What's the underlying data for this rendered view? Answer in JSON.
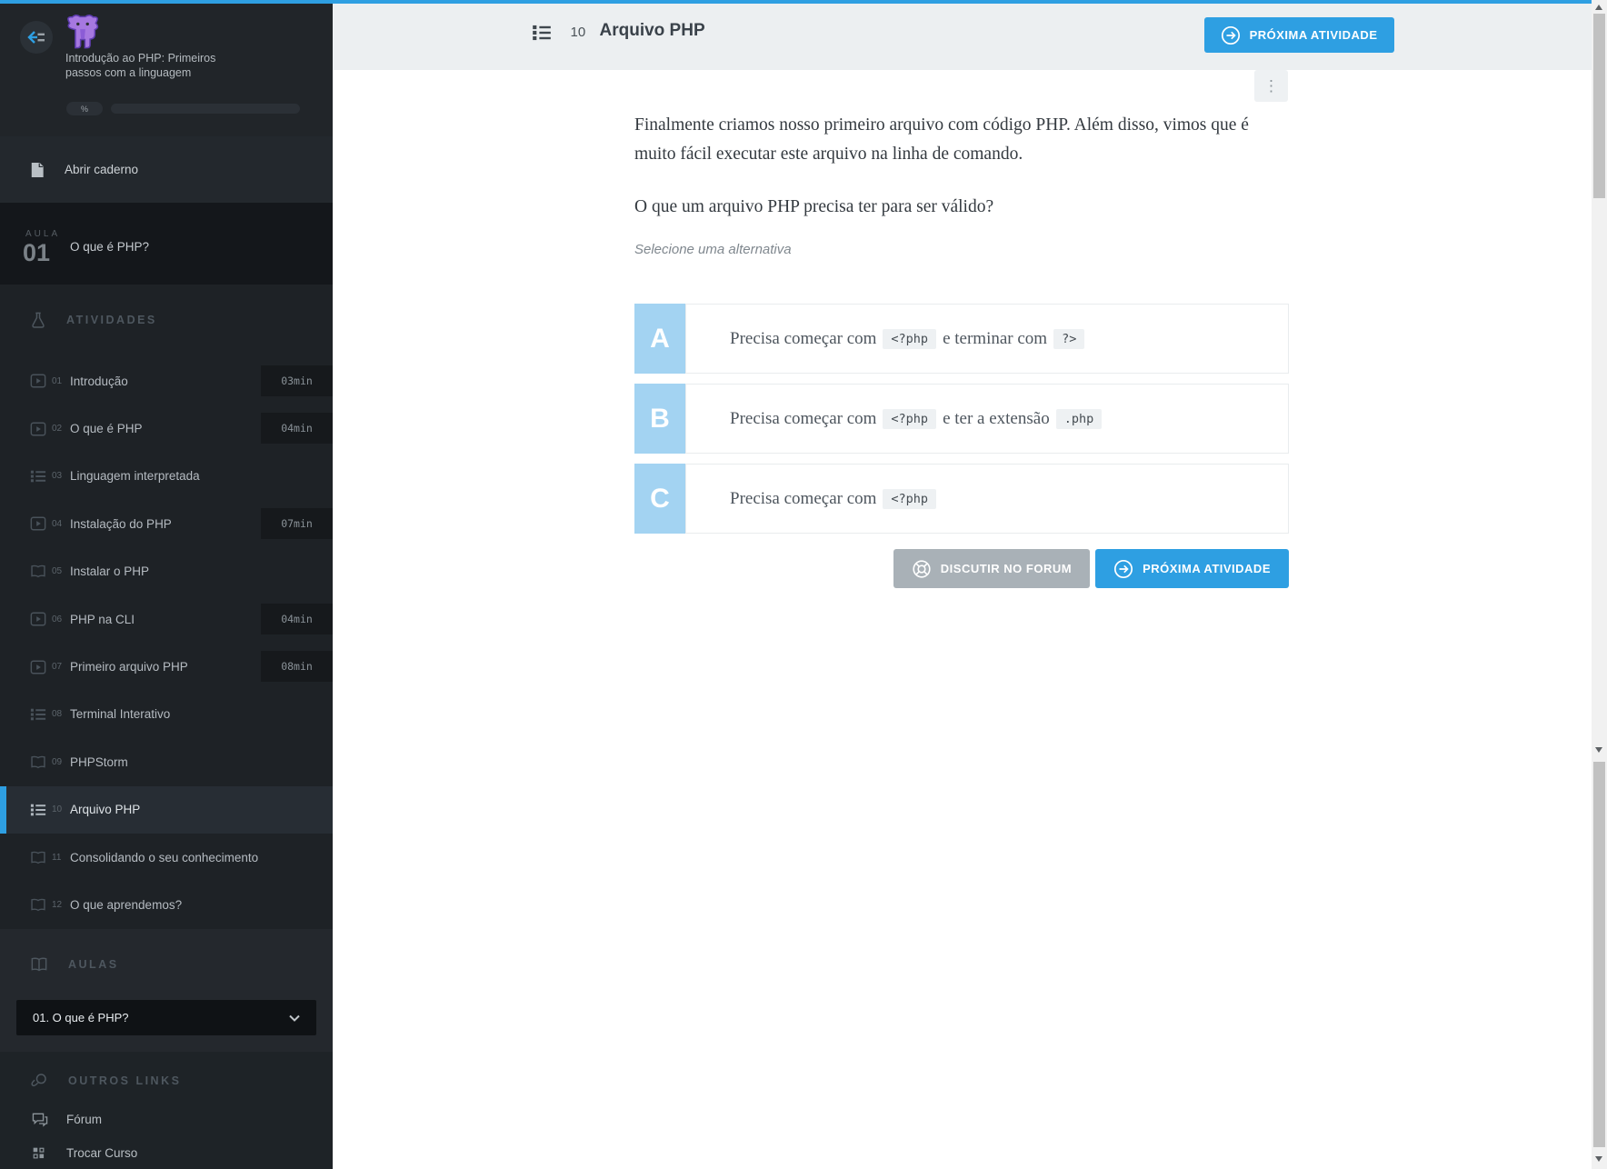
{
  "colors": {
    "accent_blue": "#2e9fe2",
    "option_letter_bg": "#a3d3f2",
    "sidebar_bg": "#1e2226",
    "header_bg": "#eceff1",
    "forum_button_bg": "#a9b1b7"
  },
  "sidebar": {
    "logo_icon": "php-elephant-logo",
    "course_title": "Introdução ao PHP: Primeiros passos com a linguagem",
    "progress_label": "%",
    "notebook_label": "Abrir caderno",
    "lesson_banner": {
      "kicker": "AULA",
      "number": "01",
      "title": "O que é PHP?"
    },
    "activities_header": "ATIVIDADES",
    "activities": [
      {
        "num": "01",
        "label": "Introdução",
        "icon": "video",
        "time": "03min",
        "active": false
      },
      {
        "num": "02",
        "label": "O que é PHP",
        "icon": "video",
        "time": "04min",
        "active": false
      },
      {
        "num": "03",
        "label": "Linguagem interpretada",
        "icon": "list",
        "time": "",
        "active": false
      },
      {
        "num": "04",
        "label": "Instalação do PHP",
        "icon": "video",
        "time": "07min",
        "active": false
      },
      {
        "num": "05",
        "label": "Instalar o PHP",
        "icon": "book",
        "time": "",
        "active": false
      },
      {
        "num": "06",
        "label": "PHP na CLI",
        "icon": "video",
        "time": "04min",
        "active": false
      },
      {
        "num": "07",
        "label": "Primeiro arquivo PHP",
        "icon": "video",
        "time": "08min",
        "active": false
      },
      {
        "num": "08",
        "label": "Terminal Interativo",
        "icon": "list",
        "time": "",
        "active": false
      },
      {
        "num": "09",
        "label": "PHPStorm",
        "icon": "book",
        "time": "",
        "active": false
      },
      {
        "num": "10",
        "label": "Arquivo PHP",
        "icon": "list",
        "time": "",
        "active": true
      },
      {
        "num": "11",
        "label": "Consolidando o seu conhecimento",
        "icon": "book",
        "time": "",
        "active": false
      },
      {
        "num": "12",
        "label": "O que aprendemos?",
        "icon": "book",
        "time": "",
        "active": false
      }
    ],
    "aulas_header": "AULAS",
    "lesson_select_value": "01. O que é PHP?",
    "links_header": "OUTROS LINKS",
    "links": [
      {
        "icon": "chat-icon",
        "label": "Fórum"
      },
      {
        "icon": "grid-icon",
        "label": "Trocar Curso"
      }
    ]
  },
  "header": {
    "number": "10",
    "title": "Arquivo PHP",
    "next_button": "PRÓXIMA ATIVIDADE"
  },
  "content": {
    "paragraph": "Finalmente criamos nosso primeiro arquivo com código PHP. Além disso, vimos que é muito fácil executar este arquivo na linha de comando.",
    "question": "O que um arquivo PHP precisa ter para ser válido?",
    "instruction": "Selecione uma alternativa",
    "options": [
      {
        "letter": "A",
        "parts": [
          {
            "t": "text",
            "v": "Precisa começar com"
          },
          {
            "t": "code",
            "v": "<?php"
          },
          {
            "t": "text",
            "v": "e terminar com"
          },
          {
            "t": "code",
            "v": "?>"
          }
        ]
      },
      {
        "letter": "B",
        "parts": [
          {
            "t": "text",
            "v": "Precisa começar com"
          },
          {
            "t": "code",
            "v": "<?php"
          },
          {
            "t": "text",
            "v": "e ter a extensão"
          },
          {
            "t": "code",
            "v": ".php"
          }
        ]
      },
      {
        "letter": "C",
        "parts": [
          {
            "t": "text",
            "v": "Precisa começar com"
          },
          {
            "t": "code",
            "v": "<?php"
          }
        ]
      }
    ],
    "forum_button": "DISCUTIR NO FORUM",
    "next_button": "PRÓXIMA ATIVIDADE"
  }
}
